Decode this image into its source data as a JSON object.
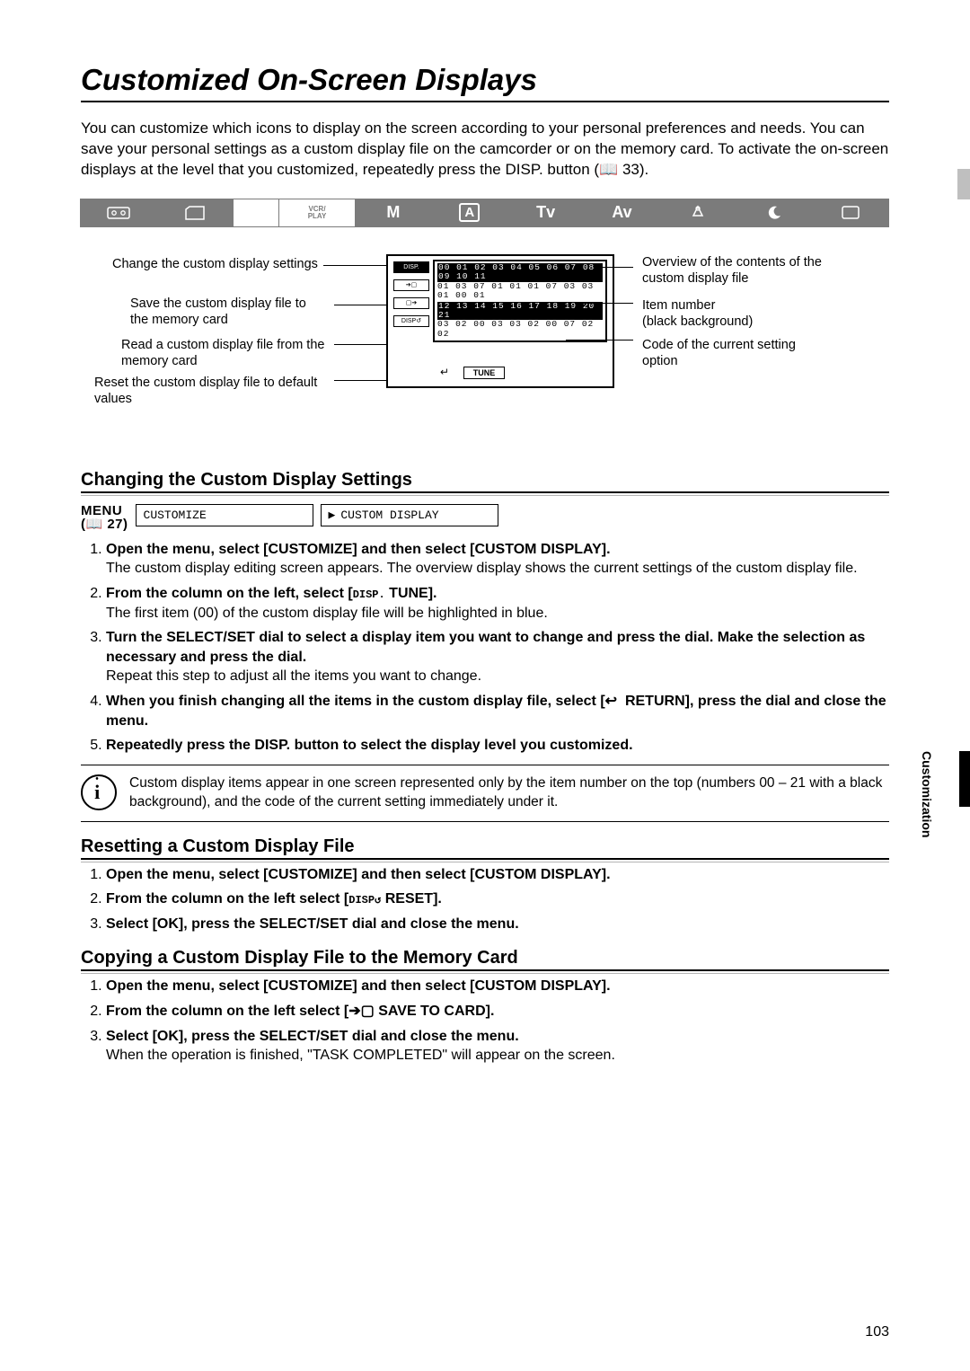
{
  "title": "Customized On-Screen Displays",
  "intro": "You can customize which icons to display on the screen according to your personal preferences and needs. You can save your personal settings as a custom display file on the camcorder or on the memory card. To activate the on-screen displays at the level that you customized, repeatedly press the DISP. button (📖 33).",
  "mode_bar": {
    "vcr_play": "VCR/\nPLAY",
    "m": "M",
    "a": "A",
    "tv": "Tv",
    "av": "Av"
  },
  "diagram": {
    "left": {
      "change": "Change the custom display settings",
      "save": "Save the custom display file to the memory card",
      "read": "Read a custom display file from the memory card",
      "reset": "Reset the custom display file to default values"
    },
    "right": {
      "overview": "Overview of the contents of the custom display file",
      "item": "Item number\n(black background)",
      "code": "Code of the current setting option"
    },
    "screen": {
      "row1_top": "00 01 02 03 04 05 06 07 08 09 10 11",
      "row1_bot": "01 03 07 01 01 01 07 03 03 01 00 01",
      "row2_top": "12 13 14 15 16 17 18 19 20 21",
      "row2_bot": "03 02 00 03 03 02 00 07 02 02",
      "tune": "TUNE"
    }
  },
  "sec_changing": "Changing the Custom Display Settings",
  "menu": {
    "label": "MENU",
    "ref": "(📖 27)",
    "box1": "CUSTOMIZE",
    "box2": "CUSTOM DISPLAY"
  },
  "steps_changing": [
    {
      "t": "Open the menu, select [CUSTOMIZE] and then select [CUSTOM DISPLAY].",
      "b": "The custom display editing screen appears. The overview display shows the current settings of the custom display file."
    },
    {
      "t": "From the column on the left, select [ DISP. TUNE].",
      "b": "The first item (00) of the custom display file will be highlighted in blue."
    },
    {
      "t": "Turn the SELECT/SET dial to select a display item you want to change and press the dial. Make the selection as necessary and press the dial.",
      "b": "Repeat this step to adjust all the items you want to change."
    },
    {
      "t": "When you finish changing all the items in the custom display file, select [↩  RETURN], press the dial and close the menu.",
      "b": ""
    },
    {
      "t": "Repeatedly press the DISP. button to select the display level you customized.",
      "b": ""
    }
  ],
  "info_note": "Custom display items appear in one screen represented only by the item number on the top (numbers 00 – 21 with a black background), and the code of the current setting immediately under it.",
  "sec_reset": "Resetting a Custom Display File",
  "steps_reset": [
    {
      "t": "Open the menu, select [CUSTOMIZE] and then select [CUSTOM DISPLAY]."
    },
    {
      "t": "From the column on the left select [ DISP↺ RESET]."
    },
    {
      "t": "Select [OK], press the SELECT/SET dial and close the menu."
    }
  ],
  "sec_copy": "Copying a Custom Display File to the Memory Card",
  "steps_copy": [
    {
      "t": "Open the menu, select [CUSTOMIZE] and then select [CUSTOM DISPLAY]."
    },
    {
      "t": "From the column on the left select [ ➔▢ SAVE TO CARD]."
    },
    {
      "t": "Select [OK], press the SELECT/SET dial and close the menu.",
      "b": "When the operation is finished, \"TASK COMPLETED\" will appear on the screen."
    }
  ],
  "side_label": "Customization",
  "page_number": "103"
}
